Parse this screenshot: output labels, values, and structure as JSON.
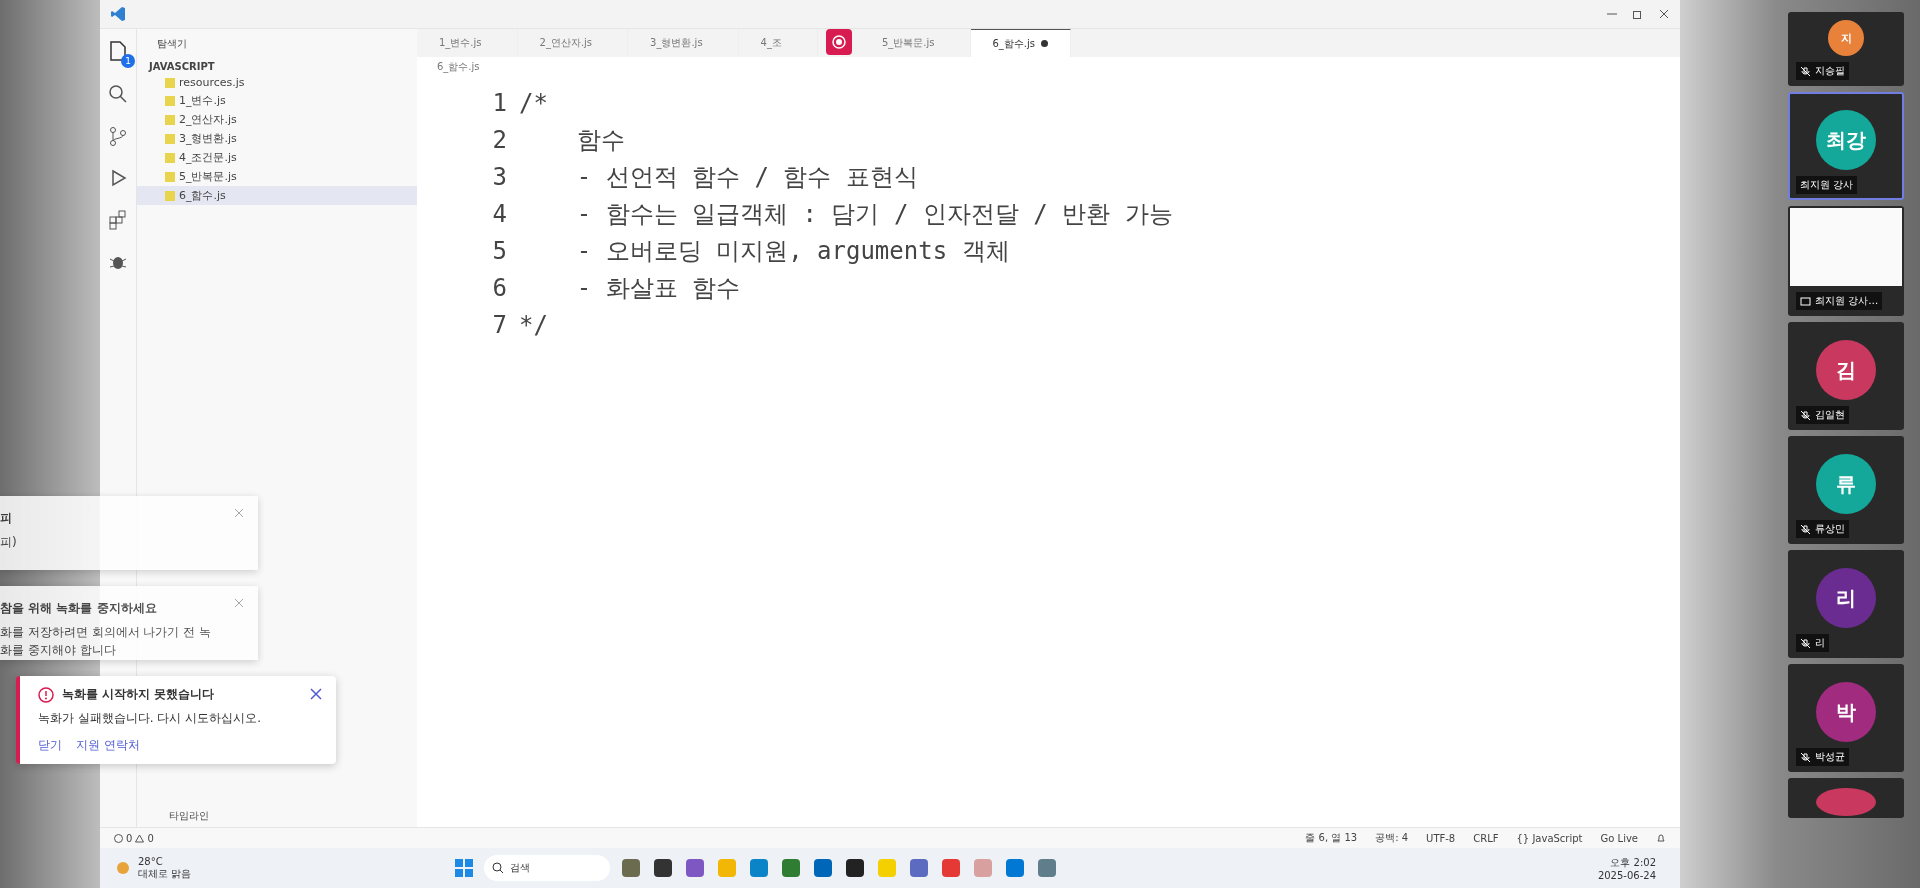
{
  "activity_bar": {
    "badge": "1"
  },
  "explorer": {
    "title": "탐색기",
    "folder": "JAVASCRIPT",
    "files": [
      {
        "label": "resources.js",
        "selected": false
      },
      {
        "label": "1_변수.js",
        "selected": false
      },
      {
        "label": "2_연산자.js",
        "selected": false
      },
      {
        "label": "3_형변환.js",
        "selected": false
      },
      {
        "label": "4_조건문.js",
        "selected": false
      },
      {
        "label": "5_반복문.js",
        "selected": false
      },
      {
        "label": "6_함수.js",
        "selected": true
      }
    ],
    "bottom_sections": [
      "타임라인"
    ]
  },
  "tabs": [
    {
      "label": "1_변수.js",
      "selected": false,
      "modified": false
    },
    {
      "label": "2_연산자.js",
      "selected": false,
      "modified": false
    },
    {
      "label": "3_형변환.js",
      "selected": false,
      "modified": false
    },
    {
      "label": "4_조",
      "selected": false,
      "modified": false
    },
    {
      "label": "5_반복문.js",
      "selected": false,
      "modified": false
    },
    {
      "label": "6_함수.js",
      "selected": true,
      "modified": true
    }
  ],
  "breadcrumb": "6_함수.js",
  "code_lines": [
    {
      "number": "1",
      "text": "/*"
    },
    {
      "number": "2",
      "text": "    함수"
    },
    {
      "number": "3",
      "text": "    - 선언적 함수 / 함수 표현식"
    },
    {
      "number": "4",
      "text": "    - 함수는 일급객체 : 담기 / 인자전달 / 반환 가능"
    },
    {
      "number": "5",
      "text": "    - 오버로딩 미지원, arguments 객체"
    },
    {
      "number": "6",
      "text": "    - 화살표 함수"
    },
    {
      "number": "7",
      "text": "*/"
    }
  ],
  "status_bar": {
    "problems": "0",
    "warnings": "0",
    "items": [
      "줄 6, 열 13",
      "공백: 4",
      "UTF-8",
      "CRLF",
      "{} JavaScript",
      "Go Live"
    ]
  },
  "taskbar": {
    "temperature": "28°C",
    "weather": "대체로 맑음",
    "search": "검색",
    "time": "오후 2:02",
    "date": "2025-06-24"
  },
  "notifications": [
    {
      "kind": "partial",
      "title": "피",
      "body": "피)"
    },
    {
      "kind": "partial",
      "title": "참을 위해 녹화를 중지하세요",
      "body": "화를 저장하려면 회의에서 나가기 전 녹화를 중지해야 합니다"
    },
    {
      "kind": "error",
      "title": "녹화를 시작하지 못했습니다",
      "body": "녹화가 실패했습니다. 다시 시도하십시오.",
      "links": [
        "닫기",
        "지원 연락처"
      ]
    }
  ],
  "participants": [
    {
      "kind": "avatar",
      "name": "지승필",
      "initials": "지",
      "color": "#e8823a",
      "selected": false
    },
    {
      "kind": "avatar",
      "name": "최지원 강사",
      "initials": "최강",
      "color": "#14a89a",
      "selected": true
    },
    {
      "kind": "screen",
      "name": "최지원 강사…",
      "selected": false
    },
    {
      "kind": "avatar",
      "name": "김일현",
      "initials": "김",
      "color": "#c8385f",
      "selected": false
    },
    {
      "kind": "avatar",
      "name": "류상민",
      "initials": "류",
      "color": "#14a89a",
      "selected": false
    },
    {
      "kind": "avatar",
      "name": "리",
      "initials": "리",
      "color": "#6b2c91",
      "selected": false
    },
    {
      "kind": "avatar",
      "name": "박성균",
      "initials": "박",
      "color": "#a02b7f",
      "selected": false
    }
  ]
}
